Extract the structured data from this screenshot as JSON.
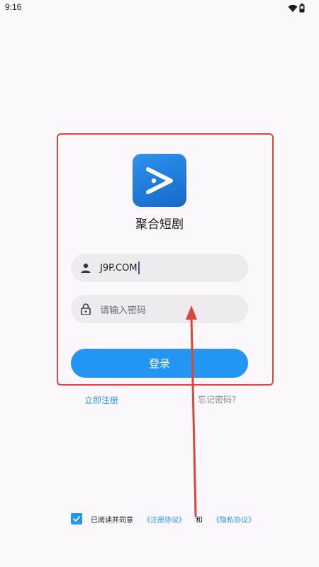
{
  "status_bar": {
    "time": "9:16",
    "icons": [
      "wifi-icon",
      "battery-icon"
    ]
  },
  "app": {
    "name": "聚合短剧",
    "logo_icon": "play-logo-icon"
  },
  "form": {
    "username_value": "J9P.COM",
    "password_placeholder": "请输入密码",
    "login_label": "登录"
  },
  "links": {
    "register": "立即注册",
    "forgot_password": "忘记密码?"
  },
  "agreement": {
    "checked": true,
    "prefix": "已阅读并同意",
    "terms": "《注册协议》",
    "and": "和",
    "privacy": "《隐私协议》"
  },
  "colors": {
    "accent": "#2196f3",
    "annotation": "#d9473a",
    "background": "#fcf7fc",
    "field_bg": "#efeaf0"
  }
}
